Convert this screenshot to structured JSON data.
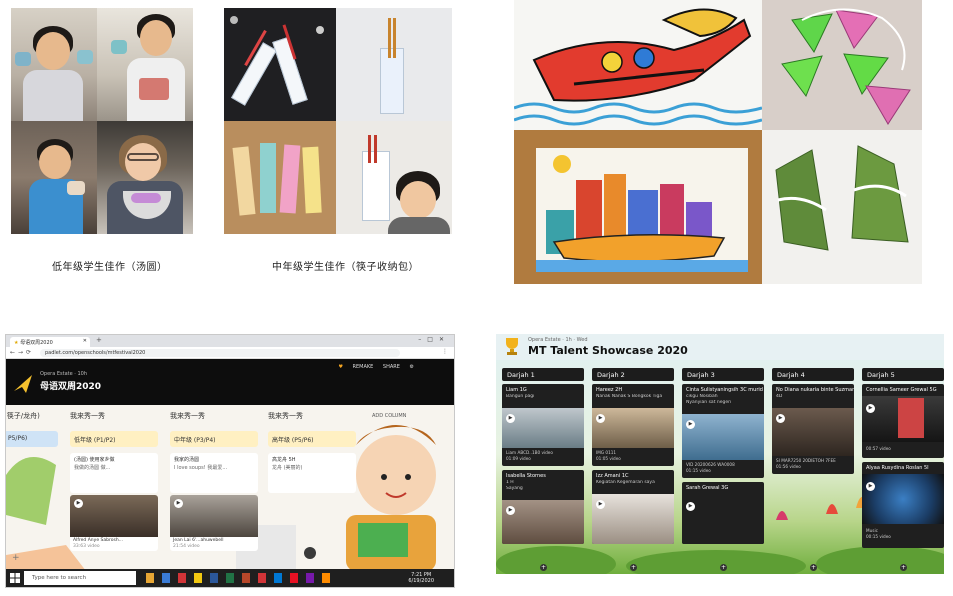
{
  "lower_grade": {
    "caption": "低年级学生佳作（汤圆）"
  },
  "middle_grade": {
    "caption": "中年级学生佳作（筷子收纳包）"
  },
  "padlet_window": {
    "tab_title": "母语双周2020",
    "url": "padlet.com/openschools/mtfestival2020",
    "author_meta": "Opera Estate · 10h",
    "board_title": "母语双周2020",
    "actions": [
      "REMAKE",
      "SHARE"
    ],
    "columns": [
      {
        "header": "(筷子/龙舟)",
        "card": "P5/P6)"
      },
      {
        "header": "我来秀一秀",
        "card": "低年级 (P1/P2)",
        "post": [
          "(汤圆) 使用家乡做",
          "我做的汤圆 做..."
        ],
        "video_title": "Alfred Anye Sabrosh...",
        "video_sub": "33:63 video"
      },
      {
        "header": "我来秀一秀",
        "card": "中年级 (P3/P4)",
        "post": [
          "我家的汤圆",
          "I love soups! 我最爱..."
        ],
        "video_title": "Jean Lai 6'...ahuwebell",
        "video_sub": "21:54 video"
      },
      {
        "header": "我来秀一秀",
        "card": "高年级 (P5/P6)",
        "post": [
          "高龙舟 5H",
          "龙舟 (美丽的)"
        ]
      }
    ],
    "add_column": "ADD COLUMN",
    "taskbar": {
      "search_placeholder": "Type here to search",
      "time": "7:21 PM",
      "date": "6/19/2020"
    }
  },
  "talent_window": {
    "meta": "Opera Estate · 1h · Wed",
    "title": "MT Talent Showcase 2020",
    "columns": [
      {
        "header": "Darjah 1",
        "posts": [
          {
            "title": "Liam 1G",
            "sub": "Bangun pagi",
            "caption": "Liam ABCD..1B0 video",
            "dur": "01:09 video"
          },
          {
            "title": "Isabella Stornes",
            "sub": "1 H",
            "extra": "Sayang"
          }
        ]
      },
      {
        "header": "Darjah 2",
        "posts": [
          {
            "title": "Hareez 2H",
            "sub": "Nanak Nanak S Bongkok Tiga",
            "caption": "IMG 0111",
            "dur": "01:05 video"
          },
          {
            "title": "Izz Amani 1C",
            "sub": "Kegiatan Kegemaran saya"
          }
        ]
      },
      {
        "header": "Darjah 3",
        "posts": [
          {
            "title": "Cinta Sulistyaningsih 3C murid",
            "sub": "cikgu Nosibah",
            "extra": "Nyanyian sat negeri",
            "caption": "VID 20200626 WA0008",
            "dur": "01:15 video"
          },
          {
            "title": "Sarah Grewal 3G",
            "sub": ""
          }
        ]
      },
      {
        "header": "Darjah 4",
        "posts": [
          {
            "title": "No Diana nukaria binte Suzman",
            "sub": "4D",
            "caption": "SI MAR7250 20DIETOH 7FEE",
            "dur": "01:56 video"
          }
        ]
      },
      {
        "header": "Darjah 5",
        "posts": [
          {
            "title": "Cornellia Sameer Grewal 5G",
            "sub": "",
            "dur": "00:57 video"
          },
          {
            "title": "Alyaa Rusydina Roslan 5I",
            "sub": "",
            "caption": "Music",
            "dur": "00:15 video"
          }
        ]
      }
    ]
  }
}
